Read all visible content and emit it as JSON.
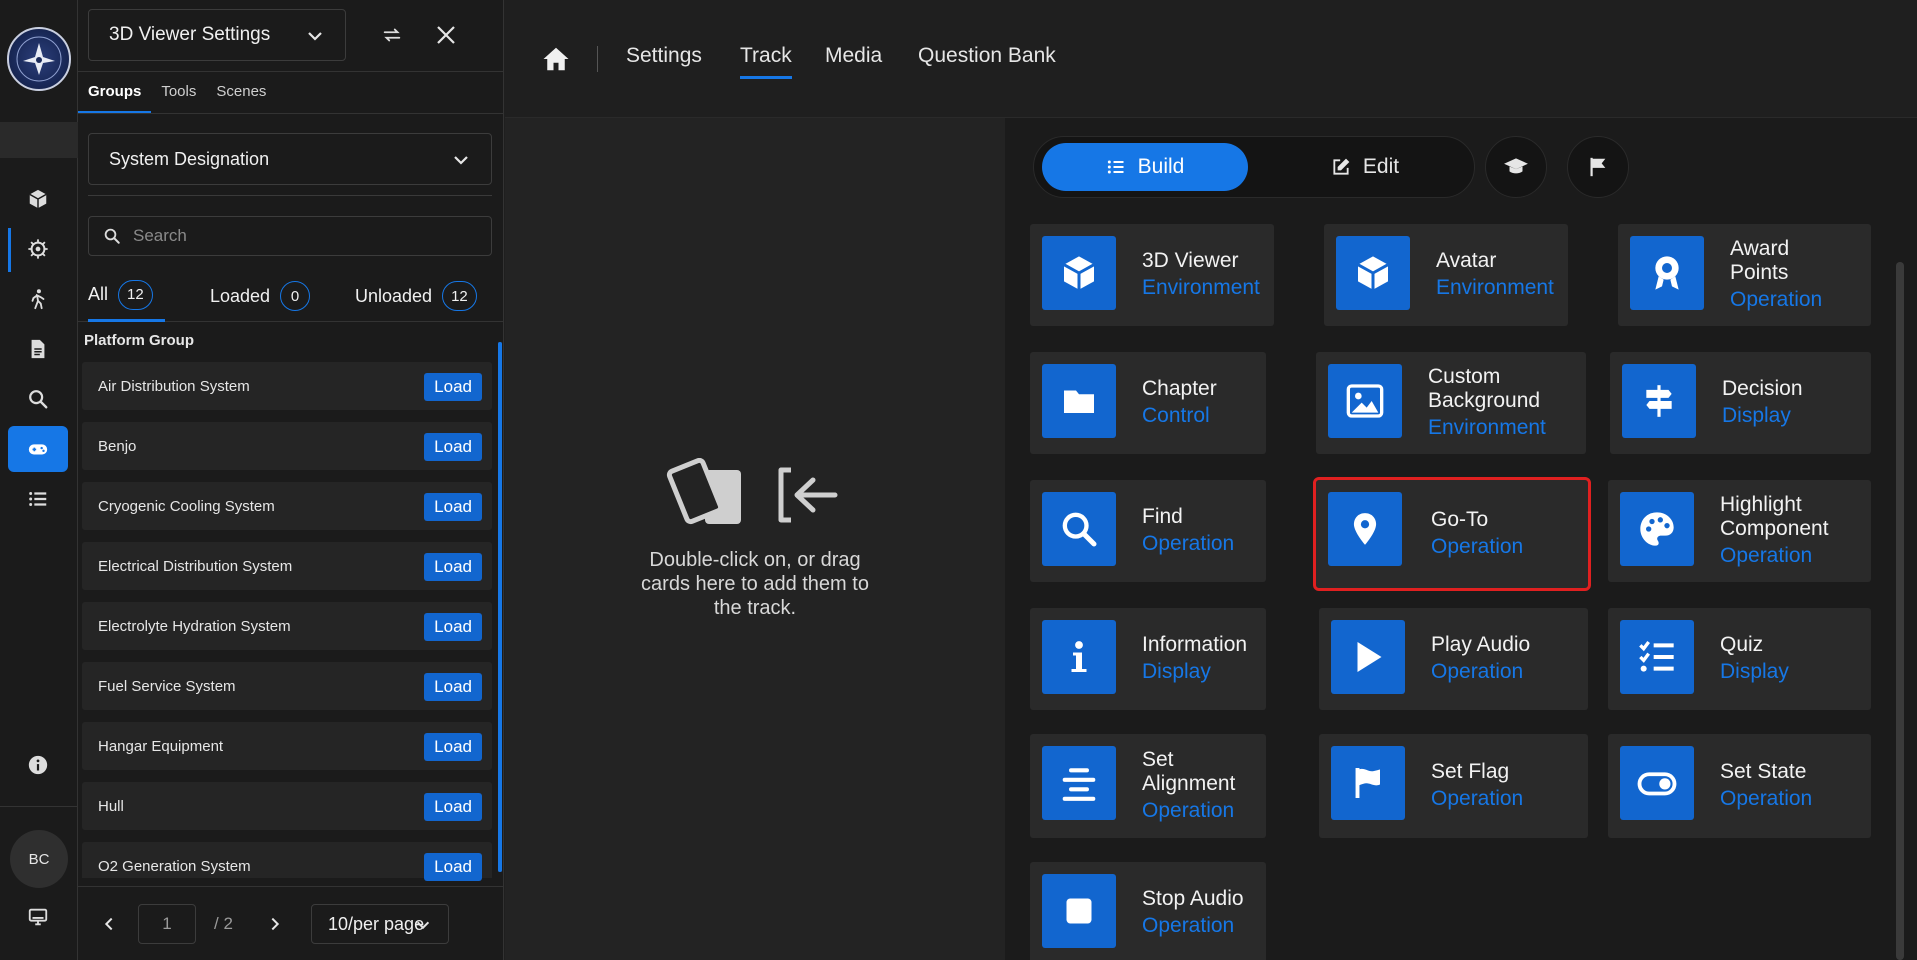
{
  "rail": {
    "avatar_initials": "BC",
    "items": [
      {
        "icon": "cube-icon"
      },
      {
        "icon": "gear-icon"
      },
      {
        "icon": "walk-icon"
      },
      {
        "icon": "document-icon"
      },
      {
        "icon": "search-icon"
      },
      {
        "icon": "gamepad-icon"
      },
      {
        "icon": "list-icon"
      }
    ]
  },
  "panel": {
    "viewer_select": "3D Viewer Settings",
    "subtabs": [
      "Groups",
      "Tools",
      "Scenes"
    ],
    "system_select": "System Designation",
    "search_placeholder": "Search",
    "filters": [
      {
        "label": "All",
        "count": "12"
      },
      {
        "label": "Loaded",
        "count": "0"
      },
      {
        "label": "Unloaded",
        "count": "12"
      }
    ],
    "group_title": "Platform Group",
    "load_label": "Load",
    "items": [
      "Air Distribution System",
      "Benjo",
      "Cryogenic Cooling System",
      "Electrical Distribution System",
      "Electrolyte Hydration System",
      "Fuel Service System",
      "Hangar Equipment",
      "Hull",
      "O2 Generation System"
    ],
    "pager": {
      "page": "1",
      "total": "/ 2",
      "per_page": "10/per page"
    }
  },
  "nav": {
    "items": [
      "Settings",
      "Track",
      "Media",
      "Question Bank"
    ],
    "active": "Track"
  },
  "dropzone": {
    "text": "Double-click on, or drag cards here to add them to the track."
  },
  "toolbar": {
    "build_label": "Build",
    "edit_label": "Edit"
  },
  "cards": [
    {
      "name": "3D Viewer",
      "category": "Environment",
      "icon": "cube-icon"
    },
    {
      "name": "Avatar",
      "category": "Environment",
      "icon": "cube-icon"
    },
    {
      "name": "Award Points",
      "category": "Operation",
      "icon": "award-icon"
    },
    {
      "name": "Chapter",
      "category": "Control",
      "icon": "folder-icon"
    },
    {
      "name": "Custom Background",
      "category": "Environment",
      "icon": "image-icon"
    },
    {
      "name": "Decision",
      "category": "Display",
      "icon": "signpost-icon"
    },
    {
      "name": "Find",
      "category": "Operation",
      "icon": "search-icon"
    },
    {
      "name": "Go-To",
      "category": "Operation",
      "icon": "map-pin-icon"
    },
    {
      "name": "Highlight Component",
      "category": "Operation",
      "icon": "palette-icon"
    },
    {
      "name": "Information",
      "category": "Display",
      "icon": "info-icon"
    },
    {
      "name": "Play Audio",
      "category": "Operation",
      "icon": "play-icon"
    },
    {
      "name": "Quiz",
      "category": "Display",
      "icon": "checklist-icon"
    },
    {
      "name": "Set Alignment",
      "category": "Operation",
      "icon": "align-center-icon"
    },
    {
      "name": "Set Flag",
      "category": "Operation",
      "icon": "flag-icon"
    },
    {
      "name": "Set State",
      "category": "Operation",
      "icon": "toggle-icon"
    },
    {
      "name": "Stop Audio",
      "category": "Operation",
      "icon": "stop-icon"
    }
  ],
  "colors": {
    "accent": "#1677e6",
    "card_icon_bg": "#1266cf",
    "highlight": "#e02020"
  }
}
